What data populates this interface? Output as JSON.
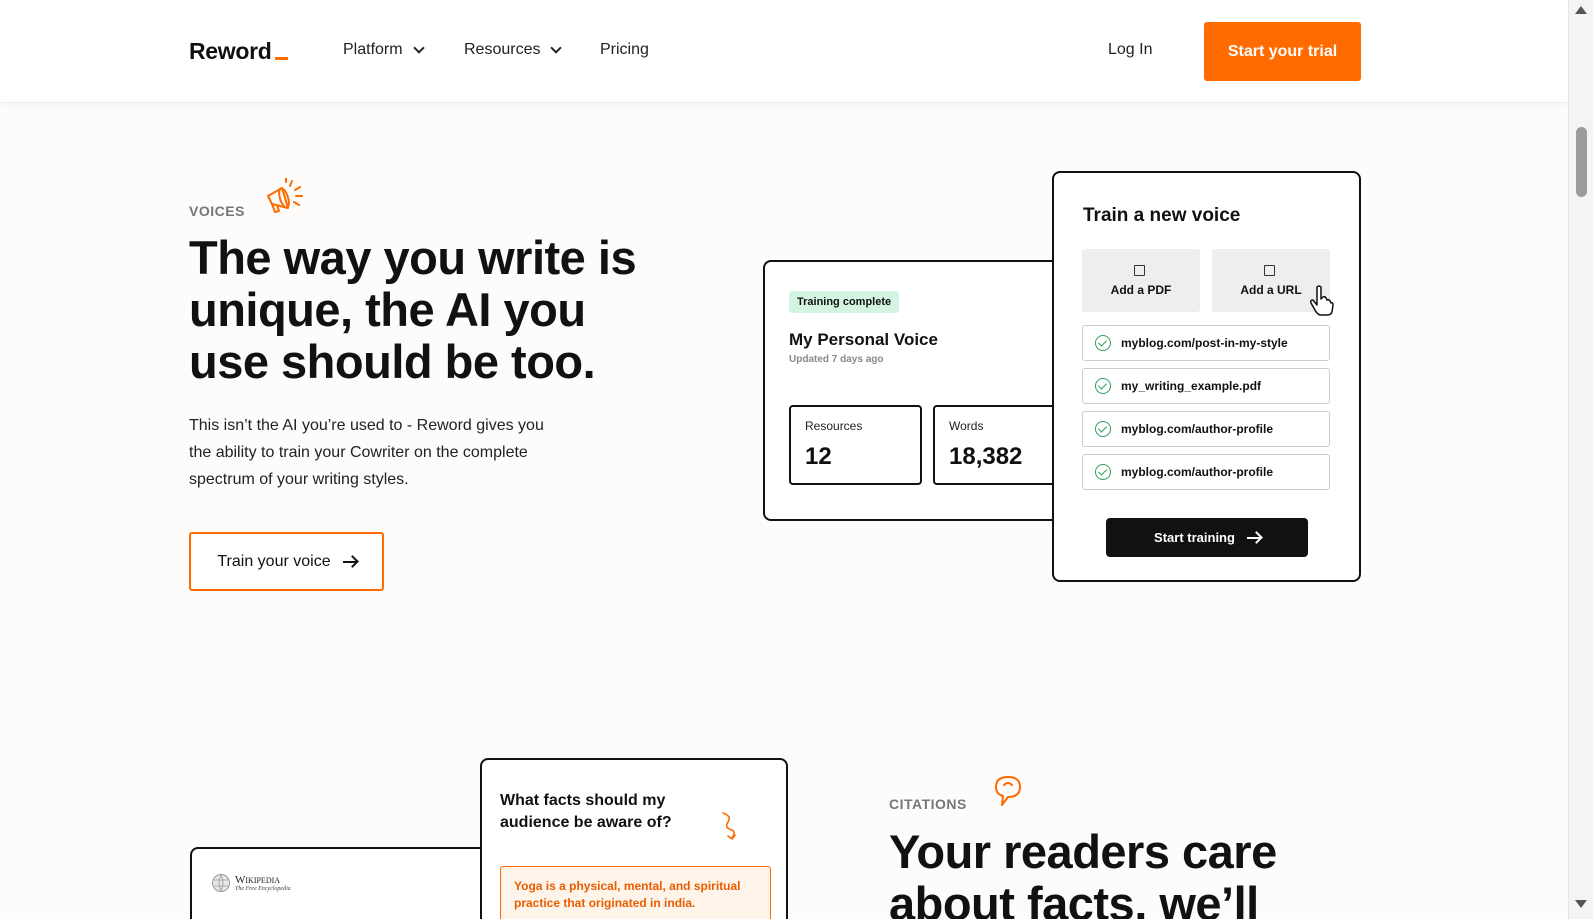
{
  "header": {
    "logo": "Reword",
    "nav": [
      {
        "label": "Platform",
        "dropdown": true
      },
      {
        "label": "Resources",
        "dropdown": true
      },
      {
        "label": "Pricing",
        "dropdown": false
      }
    ],
    "login": "Log In",
    "cta": "Start your trial"
  },
  "voices": {
    "eyebrow": "VOICES",
    "headline_lines": [
      "The way you write is",
      "unique, the AI you",
      "use should be too."
    ],
    "description": "This isn’t the AI you’re used to - Reword gives you the ability to train your Cowriter on the complete spectrum of your writing styles.",
    "button": "Train your voice",
    "voice_card": {
      "badge": "Training complete",
      "title": "My Personal Voice",
      "updated": "Updated 7 days ago",
      "stats": [
        {
          "label": "Resources",
          "value": "12"
        },
        {
          "label": "Words",
          "value": "18,382"
        }
      ]
    },
    "train_card": {
      "title": "Train a new voice",
      "add_pdf": "Add a PDF",
      "add_url": "Add a URL",
      "files": [
        "myblog.com/post-in-my-style",
        "my_writing_example.pdf",
        "myblog.com/author-profile",
        "myblog.com/author-profile"
      ],
      "start": "Start training"
    }
  },
  "citations": {
    "eyebrow": "CITATIONS",
    "headline_lines": [
      "Your readers care",
      "about facts, we’ll"
    ],
    "question": "What facts should my audience be aware of?",
    "answer": "Yoga is a physical, mental, and spiritual practice that originated in india.",
    "wiki_title": "Wikipedia",
    "wiki_sub": "The Free Encyclopedia"
  },
  "colors": {
    "accent": "#ff6b00",
    "badge_bg": "#d4f4e2",
    "check": "#2e9e5e"
  }
}
